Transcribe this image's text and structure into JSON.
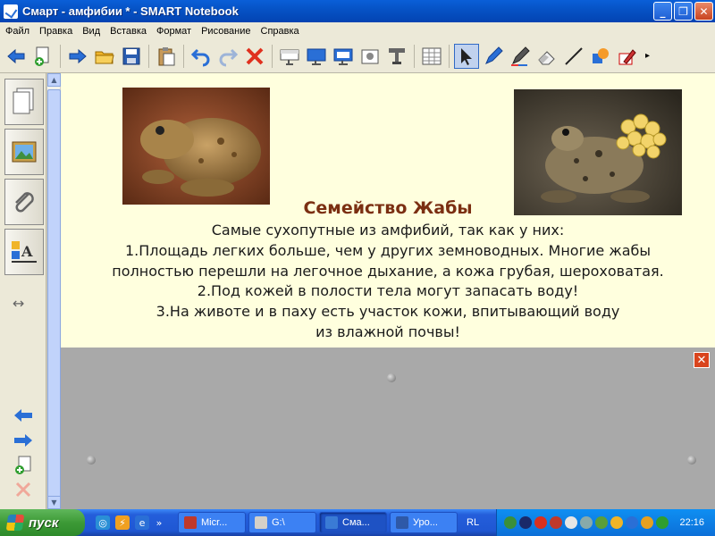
{
  "window": {
    "title": "Смарт - амфибии * - SMART Notebook",
    "minimize": "_",
    "maximize": "❐",
    "close": "✕"
  },
  "menu": [
    "Файл",
    "Правка",
    "Вид",
    "Вставка",
    "Формат",
    "Рисование",
    "Справка"
  ],
  "toolbar": {
    "icons": [
      "back-arrow-icon",
      "new-page-icon",
      "forward-arrow-icon",
      "open-folder-icon",
      "save-icon",
      "paste-icon",
      "undo-icon",
      "redo-icon",
      "delete-icon",
      "screen-shade-icon",
      "full-screen-icon",
      "dual-display-icon",
      "capture-icon",
      "table-icon",
      "select-arrow-icon",
      "pen-icon",
      "creative-pen-icon",
      "eraser-icon",
      "line-icon",
      "shapes-icon",
      "magic-pen-icon"
    ],
    "overflow": "▸"
  },
  "sidebar": {
    "tabs": [
      "page-sorter-icon",
      "gallery-icon",
      "attachments-icon",
      "properties-icon"
    ],
    "resize": "↔",
    "bottom_icons": [
      "prev-page-icon",
      "next-page-icon",
      "add-page-icon",
      "delete-page-icon"
    ]
  },
  "page": {
    "heading": "Семейство Жабы",
    "lines": [
      "Самые сухопутные из амфибий, так как у них:",
      "1.Площадь легких больше, чем у других земноводных. Многие жабы",
      "полностью перешли на легочное дыхание, а кожа грубая, шероховатая.",
      "2.Под кожей в полости тела могут запасать воду!",
      "3.На животе и в паху есть участок кожи, впитывающий воду",
      "из влажной почвы!"
    ]
  },
  "workarea": {
    "close": "✕"
  },
  "taskbar": {
    "start": "пуск",
    "quicklaunch_more": "»",
    "tasks": [
      {
        "label": "Micr...",
        "color": "#c0392b"
      },
      {
        "label": "G:\\",
        "color": "#d4d0c8"
      },
      {
        "label": "Сма...",
        "color": "#3a7bd5",
        "active": true
      },
      {
        "label": "Уро...",
        "color": "#2e59a8"
      }
    ],
    "language": "RL",
    "clock": "22:16"
  }
}
